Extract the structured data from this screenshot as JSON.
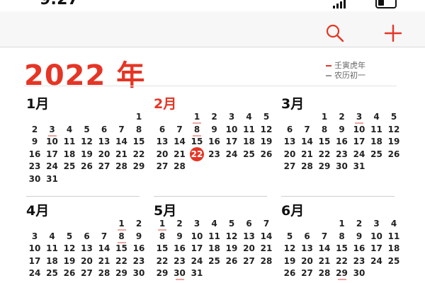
{
  "status_bar": {
    "time": "9:27"
  },
  "toolbar": {
    "search_icon": "search-icon",
    "add_icon": "plus-icon",
    "accent": "#e53525"
  },
  "header": {
    "year_title": "2022 年",
    "legend_zodiac": "壬寅虎年",
    "legend_lunar": "农历初一"
  },
  "months": [
    {
      "title": "1月",
      "offset": 6,
      "days": 31,
      "marked": [
        3
      ],
      "today": null
    },
    {
      "title": "2月",
      "offset": 2,
      "days": 28,
      "marked": [
        1,
        8
      ],
      "today": 22
    },
    {
      "title": "3月",
      "offset": 2,
      "days": 31,
      "marked": [
        3
      ],
      "today": null
    },
    {
      "title": "4月",
      "offset": 5,
      "days": 30,
      "marked": [
        1,
        8
      ],
      "today": null
    },
    {
      "title": "5月",
      "offset": 0,
      "days": 31,
      "marked": [
        1,
        30
      ],
      "today": null
    },
    {
      "title": "6月",
      "offset": 3,
      "days": 30,
      "marked": [
        29
      ],
      "today": null
    }
  ],
  "current_month_index": 1
}
